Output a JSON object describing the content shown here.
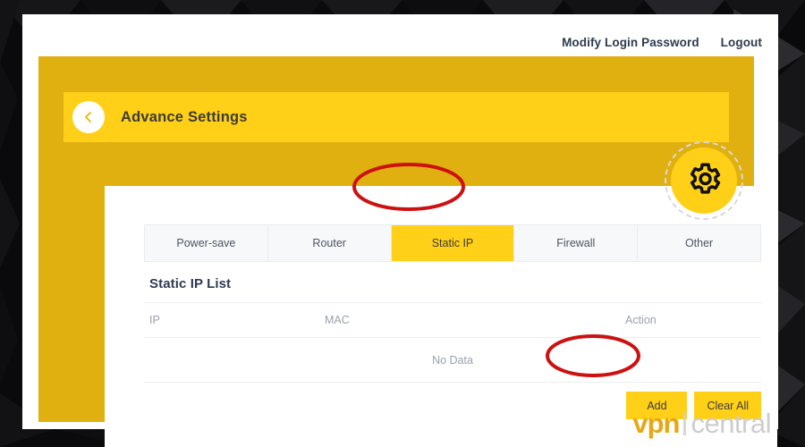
{
  "colors": {
    "panel_yellow": "#e0b011",
    "header_yellow": "#ffd017",
    "annotation_red": "#cc1111",
    "background_dark": "#0a0a0c",
    "text_dark": "#2e3b4e",
    "text_muted": "#9aa1ac"
  },
  "top_bar": {
    "modify_password_label": "Modify Login Password",
    "logout_label": "Logout"
  },
  "panel": {
    "title": "Advance Settings",
    "back_icon": "chevron-left-icon",
    "gear_icon": "gear-icon"
  },
  "tabs": [
    {
      "label": "Power-save",
      "active": false
    },
    {
      "label": "Router",
      "active": false
    },
    {
      "label": "Static IP",
      "active": true
    },
    {
      "label": "Firewall",
      "active": false
    },
    {
      "label": "Other",
      "active": false
    }
  ],
  "list": {
    "title": "Static IP List",
    "columns": [
      "IP",
      "MAC",
      "Action"
    ],
    "empty_text": "No Data",
    "rows": []
  },
  "actions": {
    "add_label": "Add",
    "clear_all_label": "Clear All"
  },
  "annotations": [
    {
      "target": "Static IP",
      "shape": "ellipse"
    },
    {
      "target": "Add",
      "shape": "ellipse"
    }
  ],
  "watermark": {
    "primary": "vpn",
    "secondary": "central"
  }
}
